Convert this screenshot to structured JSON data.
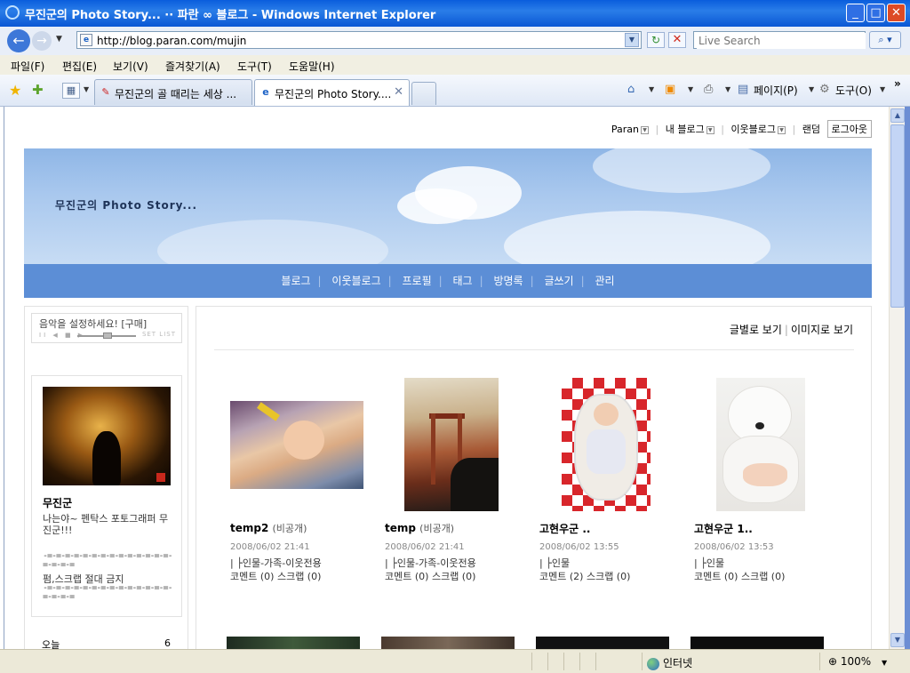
{
  "window": {
    "title": "무진군의 Photo Story... ·· 파란 ∞ 블로그 - Windows Internet Explorer",
    "minimize_icon": "minimize-icon",
    "maximize_icon": "maximize-icon",
    "close_icon": "close-icon"
  },
  "address_bar": {
    "url": "http://blog.paran.com/mujin",
    "search_placeholder": "Live Search"
  },
  "menu": [
    "파일(F)",
    "편집(E)",
    "보기(V)",
    "즐겨찾기(A)",
    "도구(T)",
    "도움말(H)"
  ],
  "tabs": [
    {
      "label": "무진군의 골 때리는 세상 ...",
      "active": false
    },
    {
      "label": "무진군의 Photo Story....",
      "active": true
    }
  ],
  "command_bar": {
    "page_label": "페이지(P)",
    "tools_label": "도구(O)",
    "chevron": "»"
  },
  "blog_topnav": {
    "paran": "Paran",
    "my_blog": "내 블로그",
    "neighbor_blog": "이웃블로그",
    "random": "랜덤",
    "logout": "로그아웃"
  },
  "blog": {
    "title": "무진군의 Photo Story...",
    "nav": [
      "블로그",
      "이웃블로그",
      "프로필",
      "태그",
      "방명록",
      "글쓰기",
      "관리"
    ]
  },
  "sidebar": {
    "music_text": "음악을 설정하세요! [구매]",
    "music_controls": "II ◀ ■ ▶",
    "music_setlist": "SET LIST",
    "profile_name": "무진군",
    "profile_desc": "나는야~ 펜탁스 포토그래퍼 무진군!!!",
    "dashes": "-=-=-=-=-=-=-=-=-=-=-=-=-=-=-=-=-=-=",
    "notice": "펌,스크랩 절대 금지",
    "today_label": "오늘",
    "today_count": "6"
  },
  "view_modes": {
    "text": "글별로 보기",
    "image": "이미지로 보기"
  },
  "posts": [
    {
      "title": "temp2",
      "visibility": "(비공개)",
      "date": "2008/06/02 21:41",
      "category": "| ├인물-가족-이웃전용",
      "comments": "코멘트 (0)",
      "scraps": "스크랩 (0)"
    },
    {
      "title": "temp",
      "visibility": "(비공개)",
      "date": "2008/06/02 21:41",
      "category": "| ├인물-가족-이웃전용",
      "comments": "코멘트 (0)",
      "scraps": "스크랩 (0)"
    },
    {
      "title": "고현우군 ..",
      "visibility": "",
      "date": "2008/06/02 13:55",
      "category": "| ├인물",
      "comments": "코멘트 (2)",
      "scraps": "스크랩 (0)"
    },
    {
      "title": "고현우군 1..",
      "visibility": "",
      "date": "2008/06/02 13:53",
      "category": "| ├인물",
      "comments": "코멘트 (0)",
      "scraps": "스크랩 (0)"
    }
  ],
  "status_bar": {
    "zone": "인터넷",
    "zoom": "100%"
  },
  "colors": {
    "title_bar": "#0a5ddc",
    "blog_nav": "#5c8ed6",
    "banner_sky": "#a9c8ee"
  }
}
